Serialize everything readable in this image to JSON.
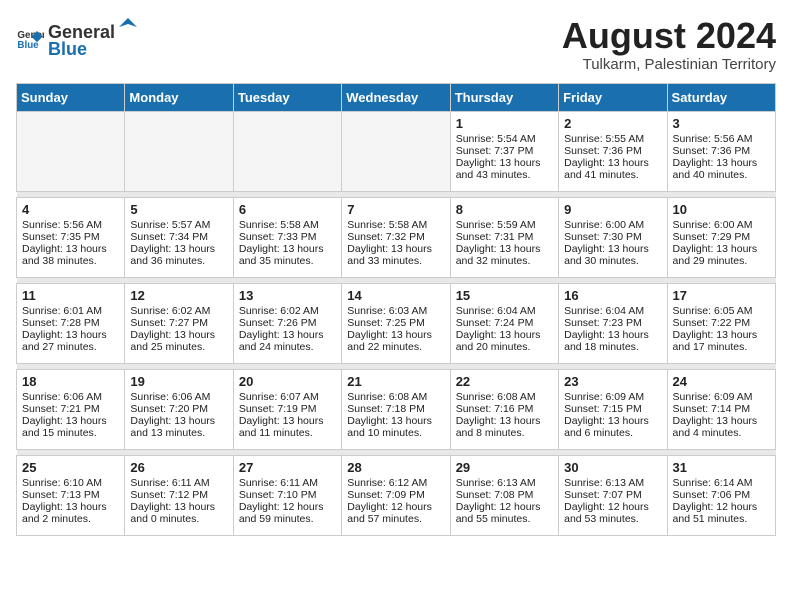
{
  "header": {
    "logo_general": "General",
    "logo_blue": "Blue",
    "month_year": "August 2024",
    "location": "Tulkarm, Palestinian Territory"
  },
  "days_of_week": [
    "Sunday",
    "Monday",
    "Tuesday",
    "Wednesday",
    "Thursday",
    "Friday",
    "Saturday"
  ],
  "weeks": [
    [
      {
        "day": "",
        "empty": true
      },
      {
        "day": "",
        "empty": true
      },
      {
        "day": "",
        "empty": true
      },
      {
        "day": "",
        "empty": true
      },
      {
        "day": "1",
        "sunrise": "5:54 AM",
        "sunset": "7:37 PM",
        "daylight": "13 hours and 43 minutes."
      },
      {
        "day": "2",
        "sunrise": "5:55 AM",
        "sunset": "7:36 PM",
        "daylight": "13 hours and 41 minutes."
      },
      {
        "day": "3",
        "sunrise": "5:56 AM",
        "sunset": "7:36 PM",
        "daylight": "13 hours and 40 minutes."
      }
    ],
    [
      {
        "day": "4",
        "sunrise": "5:56 AM",
        "sunset": "7:35 PM",
        "daylight": "13 hours and 38 minutes."
      },
      {
        "day": "5",
        "sunrise": "5:57 AM",
        "sunset": "7:34 PM",
        "daylight": "13 hours and 36 minutes."
      },
      {
        "day": "6",
        "sunrise": "5:58 AM",
        "sunset": "7:33 PM",
        "daylight": "13 hours and 35 minutes."
      },
      {
        "day": "7",
        "sunrise": "5:58 AM",
        "sunset": "7:32 PM",
        "daylight": "13 hours and 33 minutes."
      },
      {
        "day": "8",
        "sunrise": "5:59 AM",
        "sunset": "7:31 PM",
        "daylight": "13 hours and 32 minutes."
      },
      {
        "day": "9",
        "sunrise": "6:00 AM",
        "sunset": "7:30 PM",
        "daylight": "13 hours and 30 minutes."
      },
      {
        "day": "10",
        "sunrise": "6:00 AM",
        "sunset": "7:29 PM",
        "daylight": "13 hours and 29 minutes."
      }
    ],
    [
      {
        "day": "11",
        "sunrise": "6:01 AM",
        "sunset": "7:28 PM",
        "daylight": "13 hours and 27 minutes."
      },
      {
        "day": "12",
        "sunrise": "6:02 AM",
        "sunset": "7:27 PM",
        "daylight": "13 hours and 25 minutes."
      },
      {
        "day": "13",
        "sunrise": "6:02 AM",
        "sunset": "7:26 PM",
        "daylight": "13 hours and 24 minutes."
      },
      {
        "day": "14",
        "sunrise": "6:03 AM",
        "sunset": "7:25 PM",
        "daylight": "13 hours and 22 minutes."
      },
      {
        "day": "15",
        "sunrise": "6:04 AM",
        "sunset": "7:24 PM",
        "daylight": "13 hours and 20 minutes."
      },
      {
        "day": "16",
        "sunrise": "6:04 AM",
        "sunset": "7:23 PM",
        "daylight": "13 hours and 18 minutes."
      },
      {
        "day": "17",
        "sunrise": "6:05 AM",
        "sunset": "7:22 PM",
        "daylight": "13 hours and 17 minutes."
      }
    ],
    [
      {
        "day": "18",
        "sunrise": "6:06 AM",
        "sunset": "7:21 PM",
        "daylight": "13 hours and 15 minutes."
      },
      {
        "day": "19",
        "sunrise": "6:06 AM",
        "sunset": "7:20 PM",
        "daylight": "13 hours and 13 minutes."
      },
      {
        "day": "20",
        "sunrise": "6:07 AM",
        "sunset": "7:19 PM",
        "daylight": "13 hours and 11 minutes."
      },
      {
        "day": "21",
        "sunrise": "6:08 AM",
        "sunset": "7:18 PM",
        "daylight": "13 hours and 10 minutes."
      },
      {
        "day": "22",
        "sunrise": "6:08 AM",
        "sunset": "7:16 PM",
        "daylight": "13 hours and 8 minutes."
      },
      {
        "day": "23",
        "sunrise": "6:09 AM",
        "sunset": "7:15 PM",
        "daylight": "13 hours and 6 minutes."
      },
      {
        "day": "24",
        "sunrise": "6:09 AM",
        "sunset": "7:14 PM",
        "daylight": "13 hours and 4 minutes."
      }
    ],
    [
      {
        "day": "25",
        "sunrise": "6:10 AM",
        "sunset": "7:13 PM",
        "daylight": "13 hours and 2 minutes."
      },
      {
        "day": "26",
        "sunrise": "6:11 AM",
        "sunset": "7:12 PM",
        "daylight": "13 hours and 0 minutes."
      },
      {
        "day": "27",
        "sunrise": "6:11 AM",
        "sunset": "7:10 PM",
        "daylight": "12 hours and 59 minutes."
      },
      {
        "day": "28",
        "sunrise": "6:12 AM",
        "sunset": "7:09 PM",
        "daylight": "12 hours and 57 minutes."
      },
      {
        "day": "29",
        "sunrise": "6:13 AM",
        "sunset": "7:08 PM",
        "daylight": "12 hours and 55 minutes."
      },
      {
        "day": "30",
        "sunrise": "6:13 AM",
        "sunset": "7:07 PM",
        "daylight": "12 hours and 53 minutes."
      },
      {
        "day": "31",
        "sunrise": "6:14 AM",
        "sunset": "7:06 PM",
        "daylight": "12 hours and 51 minutes."
      }
    ]
  ]
}
